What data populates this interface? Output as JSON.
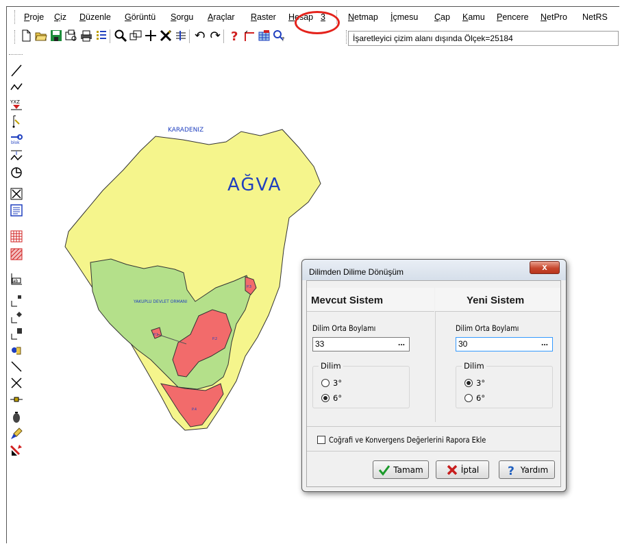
{
  "menu": {
    "items": [
      {
        "label": "Proje",
        "ul": "P"
      },
      {
        "label": "Çiz",
        "ul": "Ç"
      },
      {
        "label": "Düzenle",
        "ul": "D"
      },
      {
        "label": "Görüntü",
        "ul": "G"
      },
      {
        "label": "Sorgu",
        "ul": "S"
      },
      {
        "label": "Araçlar",
        "ul": "A"
      },
      {
        "label": "Raster",
        "ul": "R"
      },
      {
        "label": "Hesap",
        "ul": "H"
      },
      {
        "label": "3",
        "ul": "3"
      },
      {
        "label": "Netmap",
        "ul": "N"
      },
      {
        "label": "İçmesu",
        "ul": "İ"
      },
      {
        "label": "Çap",
        "ul": "Ç"
      },
      {
        "label": "Kamu",
        "ul": "K"
      },
      {
        "label": "Pencere",
        "ul": "P"
      },
      {
        "label": "NetPro",
        "ul": "N"
      },
      {
        "label": "NetRS",
        "ul": ""
      }
    ]
  },
  "toolbar": {
    "status_text": "İşaretleyici çizim alanı dışında Ölçek=25184"
  },
  "map": {
    "sea_label": "KARADENIZ",
    "town_label": "AĞVA",
    "forest_label": "YAKUPLU DEVLET ORMANI",
    "parcel_labels": [
      "P.3",
      "P.2",
      "P.1",
      "P.4"
    ],
    "colors": {
      "land": "#f5f58c",
      "forest": "#b4e08a",
      "parcel": "#f26b6b",
      "outline": "#333333",
      "label": "#1f3fbf"
    }
  },
  "dialog": {
    "title": "Dilimden Dilime Dönüşüm",
    "close_label": "x",
    "left": {
      "header": "Mevcut Sistem",
      "meridian_label": "Dilim Orta Boylamı",
      "meridian_value": "33",
      "zone_group_label": "Dilim",
      "options": [
        "3°",
        "6°"
      ],
      "selected": "6°"
    },
    "right": {
      "header": "Yeni Sistem",
      "meridian_label": "Dilim Orta Boylamı",
      "meridian_value": "30",
      "zone_group_label": "Dilim",
      "options": [
        "3°",
        "6°"
      ],
      "selected": "3°"
    },
    "dots_label": "...",
    "checkbox_label": "Coğrafi ve Konvergens Değerlerini Rapora Ekle",
    "checkbox_checked": false,
    "buttons": {
      "ok": "Tamam",
      "cancel": "İptal",
      "help": "Yardım"
    }
  }
}
